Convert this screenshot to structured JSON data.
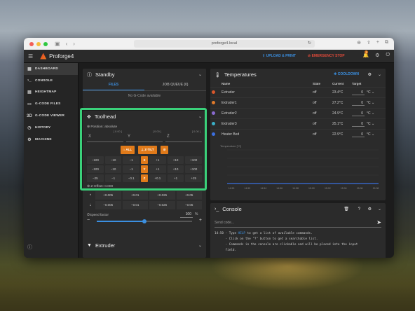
{
  "browser": {
    "url": "proforge4.local"
  },
  "app": {
    "name": "Proforge4",
    "upload_label": "UPLOAD & PRINT",
    "estop_label": "EMERGENCY STOP",
    "notif_count": "1"
  },
  "sidebar": {
    "items": [
      {
        "label": "DASHBOARD",
        "icon": "dashboard-icon",
        "glyph": "▦",
        "active": true
      },
      {
        "label": "CONSOLE",
        "icon": "console-icon",
        "glyph": "›_",
        "active": false
      },
      {
        "label": "HEIGHTMAP",
        "icon": "heightmap-icon",
        "glyph": "▤",
        "active": false
      },
      {
        "label": "G-CODE FILES",
        "icon": "file-icon",
        "glyph": "▭",
        "active": false
      },
      {
        "label": "G-CODE VIEWER",
        "icon": "viewer-icon",
        "glyph": "3D",
        "active": false
      },
      {
        "label": "HISTORY",
        "icon": "history-icon",
        "glyph": "◷",
        "active": false
      },
      {
        "label": "MACHINE",
        "icon": "machine-icon",
        "glyph": "⚙",
        "active": false
      }
    ]
  },
  "standby": {
    "title": "Standby",
    "tabs": [
      "FILES",
      "JOB QUEUE (0)"
    ],
    "empty": "No G-Code available"
  },
  "toolhead": {
    "title": "Toolhead",
    "position_label": "Position: absolute",
    "axes": [
      {
        "name": "X",
        "value": "[ 0.00 ]"
      },
      {
        "name": "Y",
        "value": "[ 0.00 ]"
      },
      {
        "name": "Z",
        "value": "[ 0.00 ]"
      }
    ],
    "home_buttons": [
      "ALL",
      "Z-TILT"
    ],
    "jog_rows": [
      {
        "axis": "X",
        "left": [
          "−100",
          "−10",
          "−1"
        ],
        "right": [
          "+1",
          "+10",
          "+100"
        ]
      },
      {
        "axis": "Y",
        "left": [
          "−100",
          "−10",
          "−1"
        ],
        "right": [
          "+1",
          "+10",
          "+100"
        ]
      },
      {
        "axis": "Z",
        "left": [
          "−25",
          "−1",
          "−0.1"
        ],
        "right": [
          "+0.1",
          "+1",
          "+25"
        ]
      }
    ],
    "z_offset_label": "Z-Offset: 0.000",
    "z_up": [
      "+0.005",
      "+0.01",
      "+0.025",
      "+0.05"
    ],
    "z_down": [
      "−0.005",
      "−0.01",
      "−0.025",
      "−0.05"
    ],
    "speed_label": "Speed factor",
    "speed_value": "100",
    "speed_unit": "%",
    "speed_fraction": 0.5
  },
  "extruder": {
    "title": "Extruder"
  },
  "temps": {
    "title": "Temperatures",
    "cooldown": "COOLDOWN",
    "headers": [
      "Name",
      "State",
      "Current",
      "Target"
    ],
    "rows": [
      {
        "name": "Extruder",
        "state": "off",
        "current": "23.4°C",
        "target": "0",
        "unit": "°C",
        "color": "#d9572b"
      },
      {
        "name": "Extruder1",
        "state": "off",
        "current": "27.2°C",
        "target": "0",
        "unit": "°C",
        "color": "#e07a2a"
      },
      {
        "name": "Extruder2",
        "state": "off",
        "current": "24.9°C",
        "target": "0",
        "unit": "°C",
        "color": "#8a6ad0"
      },
      {
        "name": "Extruder3",
        "state": "off",
        "current": "25.1°C",
        "target": "0",
        "unit": "°C",
        "color": "#3ab0c8"
      },
      {
        "name": "Heater Bed",
        "state": "off",
        "current": "22.9°C",
        "target": "0",
        "unit": "°C",
        "color": "#3b6fe0"
      }
    ],
    "chart_label": "Temperature [°C]",
    "times": [
      "14:50",
      "14:52",
      "14:54",
      "14:56",
      "14:58",
      "15:00",
      "15:02",
      "15:04",
      "15:06",
      "15:08"
    ]
  },
  "console": {
    "title": "Console",
    "placeholder": "Send code...",
    "time": "14:50",
    "lines": [
      {
        "pre": "- Type ",
        "kw": "HELP",
        "post": " to get a list of available commands."
      },
      {
        "pre": "- Click on the \"?\" button to get a searchable list.",
        "kw": "",
        "post": ""
      },
      {
        "pre": "- Commands in the console are clickable and will be placed into the input",
        "kw": "",
        "post": ""
      },
      {
        "pre": "field.",
        "kw": "",
        "post": ""
      }
    ]
  }
}
